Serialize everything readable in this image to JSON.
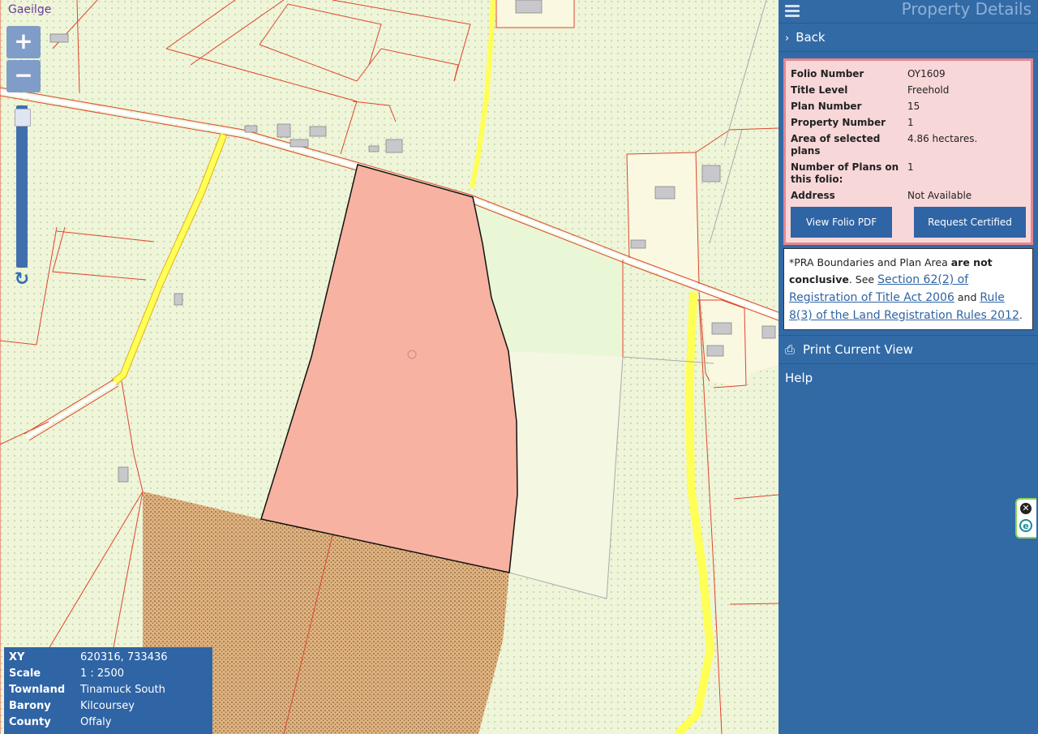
{
  "map": {
    "language_link": "Gaeilge",
    "zoom_in_label": "+",
    "zoom_out_label": "−",
    "refresh_icon": "refresh-icon",
    "colors": {
      "background": "#eef5d8",
      "boundary": "#e0452e",
      "selected_parcel": "#f7b2a2",
      "bog": "#e0b686",
      "road": "#ffff55"
    }
  },
  "info_box": {
    "rows": [
      {
        "label": "XY",
        "value": "620316, 733436"
      },
      {
        "label": "Scale",
        "value": "1 : 2500"
      },
      {
        "label": "Townland",
        "value": "Tinamuck South"
      },
      {
        "label": "Barony",
        "value": "Kilcoursey"
      },
      {
        "label": "County",
        "value": "Offaly"
      }
    ]
  },
  "panel": {
    "title": "Property Details",
    "back_label": "Back",
    "details": {
      "rows": [
        {
          "label": "Folio Number",
          "value": "OY1609"
        },
        {
          "label": "Title Level",
          "value": "Freehold"
        },
        {
          "label": "Plan Number",
          "value": "15"
        },
        {
          "label": "Property Number",
          "value": "1"
        },
        {
          "label": "Area of selected plans",
          "value": "4.86 hectares."
        },
        {
          "label": "Number of Plans on this folio:",
          "value": "1"
        },
        {
          "label": "Address",
          "value": "Not Available"
        }
      ],
      "view_pdf_label": "View Folio PDF",
      "request_copy_label": "Request Certified Copy"
    },
    "disclaimer": {
      "prefix": "*PRA Boundaries and Plan Area",
      "bold": "are not conclusive",
      "see": ". See",
      "link1": "Section 62(2) of Registration of Title Act 2006",
      "and": "and",
      "link2": "Rule 8(3) of the Land Registration Rules 2012",
      "end": "."
    },
    "print_label": "Print Current View",
    "help_label": "Help"
  },
  "side_tab": {
    "close_icon": "close-icon",
    "e_icon": "e-icon"
  }
}
